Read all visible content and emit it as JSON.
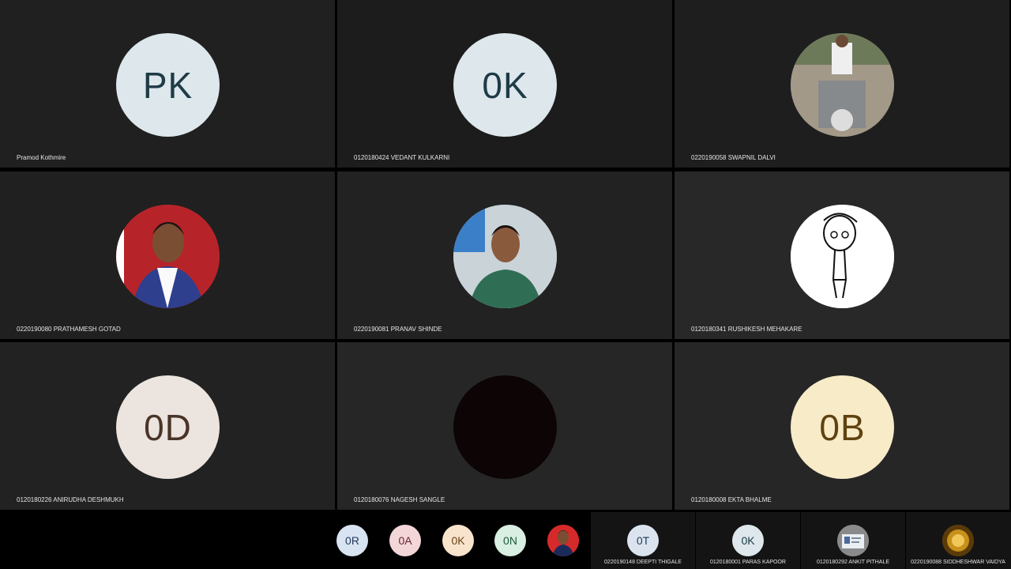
{
  "tiles": [
    {
      "name": "Pramod Kothmire",
      "initials": "PK",
      "avatar_bg": "#dde7ec",
      "text_color": "#1e3b46",
      "tile_bg": "#202020"
    },
    {
      "name": "0120180424 VEDANT KULKARNI",
      "initials": "0K",
      "avatar_bg": "#dde7ec",
      "text_color": "#1e3b46",
      "tile_bg": "#1c1c1c"
    },
    {
      "name": "0220190058 SWAPNIL DALVI",
      "initials": "",
      "avatar_bg": "#9a8f82",
      "tile_bg": "#1e1e1e"
    },
    {
      "name": "0220190080 PRATHAMESH GOTAD",
      "initials": "",
      "avatar_bg": "#b6242a",
      "tile_bg": "#202020"
    },
    {
      "name": "0220190081 PRANAV SHINDE",
      "initials": "",
      "avatar_bg": "#b9c7cf",
      "tile_bg": "#222222"
    },
    {
      "name": "0120180341 RUSHIKESH MEHAKARE",
      "initials": "",
      "avatar_bg": "#ffffff",
      "tile_bg": "#282828"
    },
    {
      "name": "0120180226 ANIRUDHA DESHMUKH",
      "initials": "0D",
      "avatar_bg": "#ece4de",
      "text_color": "#4a3428",
      "tile_bg": "#222222"
    },
    {
      "name": "0120180076 NAGESH SANGLE",
      "initials": "",
      "avatar_bg": "#0c0405",
      "tile_bg": "#262626"
    },
    {
      "name": "0120180008 EKTA BHALME",
      "initials": "0B",
      "avatar_bg": "#f8ebc8",
      "text_color": "#5e4210",
      "tile_bg": "#262626"
    }
  ],
  "strip_avatars": [
    {
      "initials": "0R",
      "avatar_bg": "#d9e4f2",
      "text_color": "#223a5e"
    },
    {
      "initials": "0A",
      "avatar_bg": "#f3d6d8",
      "text_color": "#6a2630"
    },
    {
      "initials": "0K",
      "avatar_bg": "#f8e4cc",
      "text_color": "#6a4418"
    },
    {
      "initials": "0N",
      "avatar_bg": "#d8efe2",
      "text_color": "#1e5a3a"
    },
    {
      "initials": "",
      "avatar_bg": "#d62a2a"
    }
  ],
  "strip_tiles": [
    {
      "name": "0220190148 DEEPTI THIGALE",
      "initials": "0T",
      "avatar_bg": "#dbe4ee",
      "text_color": "#1e3b5a"
    },
    {
      "name": "0120180001 PARAS KAPOOR",
      "initials": "0K",
      "avatar_bg": "#dde7ec",
      "text_color": "#1e3b46"
    },
    {
      "name": "0120180292 ANKIT PITHALE",
      "initials": "",
      "avatar_bg": "#8a8a8a"
    },
    {
      "name": "0220190088 SIDDHESHWAR VAIDYA",
      "initials": "",
      "avatar_bg": "#7a5410"
    }
  ]
}
